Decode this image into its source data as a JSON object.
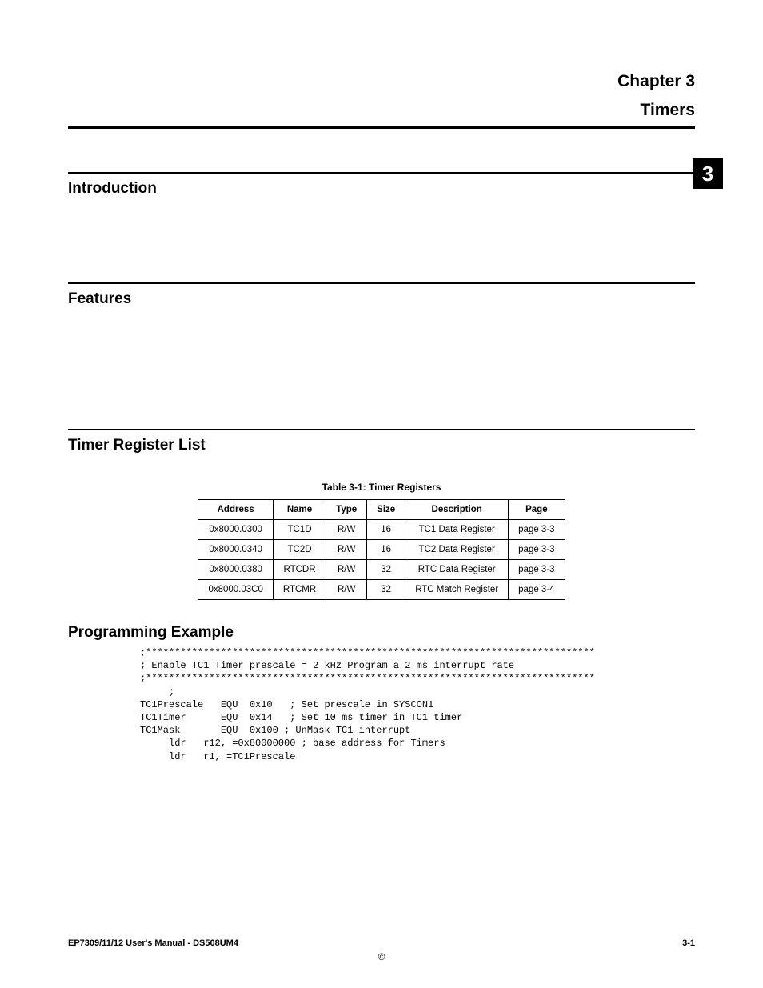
{
  "chapter": {
    "label": "Chapter 3",
    "title": "Timers",
    "tab": "3"
  },
  "sections": {
    "introduction": "Introduction",
    "features": "Features",
    "timerRegisterList": "Timer Register List",
    "programmingExample": "Programming Example"
  },
  "table": {
    "caption": "Table 3-1: Timer Registers",
    "headers": {
      "address": "Address",
      "name": "Name",
      "type": "Type",
      "size": "Size",
      "description": "Description",
      "page": "Page"
    },
    "rows": [
      {
        "address": "0x8000.0300",
        "name": "TC1D",
        "type": "R/W",
        "size": "16",
        "description": "TC1 Data Register",
        "page": "page 3-3"
      },
      {
        "address": "0x8000.0340",
        "name": "TC2D",
        "type": "R/W",
        "size": "16",
        "description": "TC2 Data Register",
        "page": "page 3-3"
      },
      {
        "address": "0x8000.0380",
        "name": "RTCDR",
        "type": "R/W",
        "size": "32",
        "description": "RTC Data Register",
        "page": "page 3-3"
      },
      {
        "address": "0x8000.03C0",
        "name": "RTCMR",
        "type": "R/W",
        "size": "32",
        "description": "RTC Match Register",
        "page": "page 3-4"
      }
    ]
  },
  "code": {
    "l1": ";******************************************************************************",
    "l2": "; Enable TC1 Timer prescale = 2 kHz Program a 2 ms interrupt rate",
    "l3": ";******************************************************************************",
    "l4": "     ;",
    "l5": "TC1Prescale   EQU  0x10   ; Set prescale in SYSCON1",
    "l6": "TC1Timer      EQU  0x14   ; Set 10 ms timer in TC1 timer",
    "l7": "TC1Mask       EQU  0x100 ; UnMask TC1 interrupt",
    "l8": "     ldr   r12, =0x80000000 ; base address for Timers",
    "l9": "     ldr   r1, =TC1Prescale"
  },
  "footer": {
    "left": "EP7309/11/12 User's Manual - DS508UM4",
    "right": "3-1",
    "copyright": "©"
  }
}
